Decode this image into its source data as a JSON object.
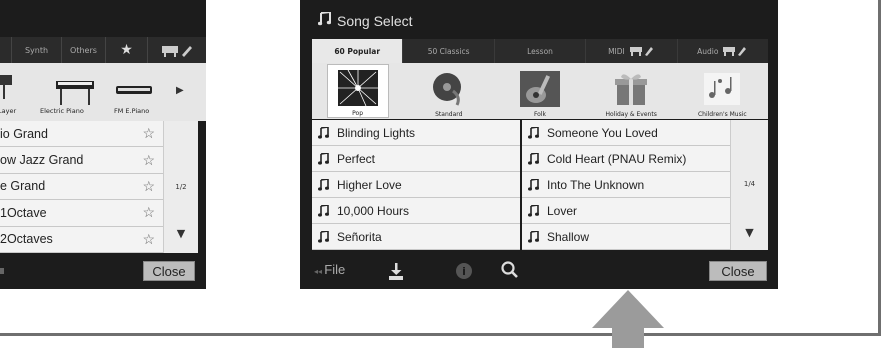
{
  "left_screen": {
    "tabs": [
      "Synth",
      "Others"
    ],
    "instruments": [
      "Layer",
      "Electric Piano",
      "FM E.Piano"
    ],
    "voices": [
      "io Grand",
      "ow Jazz Grand",
      "e Grand",
      "1Octave",
      "2Octaves"
    ],
    "page_indicator": "1/2",
    "close_label": "Close"
  },
  "song_select": {
    "title": "Song Select",
    "tabs": [
      "60 Popular",
      "50 Classics",
      "Lesson",
      "MIDI",
      "Audio"
    ],
    "active_tab": "60 Popular",
    "categories": [
      "Pop",
      "Standard",
      "Folk",
      "Holiday & Events",
      "Children's Music"
    ],
    "selected_category": "Pop",
    "songs_left": [
      "Blinding Lights",
      "Perfect",
      "Higher Love",
      "10,000 Hours",
      "Señorita"
    ],
    "songs_right": [
      "Someone You Loved",
      "Cold Heart (PNAU Remix)",
      "Into The Unknown",
      "Lover",
      "Shallow"
    ],
    "page_indicator": "1/4",
    "file_label": "File",
    "close_label": "Close"
  },
  "colors": {
    "screen_bg": "#1c1c1c",
    "list_bg": "#f3f3f3",
    "arrow": "#9b9b9b"
  },
  "icons": [
    "music-note-icon",
    "star-icon",
    "piano-edit-icon",
    "save-icon",
    "info-icon",
    "search-icon",
    "up-arrow-icon"
  ]
}
